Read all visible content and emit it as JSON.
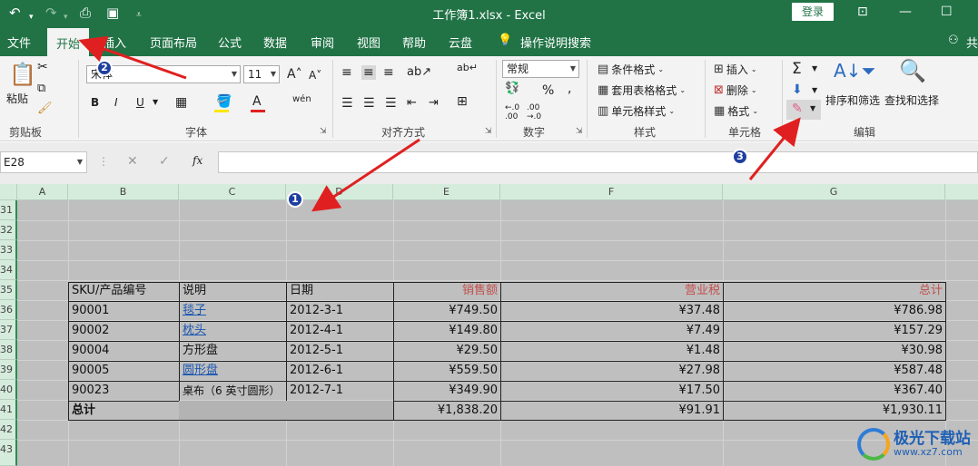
{
  "titlebar": {
    "undo_icon": "undo-icon",
    "redo_icon": "redo-icon",
    "doc_title": "工作簿1.xlsx  -  Excel",
    "login_label": "登录",
    "restore_icon": "ribbon-display-icon",
    "minimize_icon": "minimize-icon",
    "maximize_icon": "maximize-icon"
  },
  "tabs": [
    {
      "label": "文件"
    },
    {
      "label": "开始"
    },
    {
      "label": "插入"
    },
    {
      "label": "页面布局"
    },
    {
      "label": "公式"
    },
    {
      "label": "数据"
    },
    {
      "label": "审阅"
    },
    {
      "label": "视图"
    },
    {
      "label": "帮助"
    },
    {
      "label": "云盘"
    },
    {
      "label": "操作说明搜索"
    },
    {
      "label": "共"
    }
  ],
  "ribbon": {
    "clipboard": {
      "paste_label": "粘贴",
      "group_label": "剪贴板"
    },
    "font": {
      "font_name": "宋体",
      "font_size": "11",
      "bold": "B",
      "italic": "I",
      "underline": "U",
      "phonetic": "wén",
      "group_label": "字体"
    },
    "alignment": {
      "group_label": "对齐方式"
    },
    "number": {
      "format": "常规",
      "percent": "%",
      "comma": ",",
      "group_label": "数字"
    },
    "styles": {
      "conditional_format": "条件格式",
      "table_format": "套用表格格式",
      "cell_styles": "单元格样式",
      "group_label": "样式"
    },
    "cells": {
      "insert": "插入",
      "delete": "删除",
      "format": "格式",
      "group_label": "单元格"
    },
    "editing": {
      "sort_filter": "排序和筛选",
      "find_select": "查找和选择",
      "group_label": "编辑"
    }
  },
  "formula_bar": {
    "name_box": "E28",
    "fx_label": "fx",
    "formula_value": ""
  },
  "grid": {
    "columns": [
      "A",
      "B",
      "C",
      "D",
      "E",
      "F",
      "G"
    ],
    "rows": [
      "31",
      "32",
      "33",
      "34",
      "35",
      "36",
      "37",
      "38",
      "39",
      "40",
      "41",
      "42",
      "43"
    ],
    "table_header": {
      "sku": "SKU/产品编号",
      "desc": "说明",
      "date": "日期",
      "sales": "销售额",
      "tax": "营业税",
      "total": "总计"
    },
    "table_rows": [
      {
        "sku": "90001",
        "desc": "毯子",
        "date": "2012-3-1",
        "sales": "¥749.50",
        "tax": "¥37.48",
        "total": "¥786.98"
      },
      {
        "sku": "90002",
        "desc": "枕头",
        "date": "2012-4-1",
        "sales": "¥149.80",
        "tax": "¥7.49",
        "total": "¥157.29"
      },
      {
        "sku": "90004",
        "desc": "方形盘",
        "date": "2012-5-1",
        "sales": "¥29.50",
        "tax": "¥1.48",
        "total": "¥30.98"
      },
      {
        "sku": "90005",
        "desc": "圆形盘",
        "date": "2012-6-1",
        "sales": "¥559.50",
        "tax": "¥27.98",
        "total": "¥587.48"
      },
      {
        "sku": "90023",
        "desc": "桌布（6 英寸圆形）",
        "date": "2012-7-1",
        "sales": "¥349.90",
        "tax": "¥17.50",
        "total": "¥367.40"
      }
    ],
    "total_row": {
      "label": "总计",
      "sales": "¥1,838.20",
      "tax": "¥91.91",
      "total": "¥1,930.11"
    }
  },
  "annotations": {
    "badge1": "1",
    "badge2": "2",
    "badge3": "3",
    "arrow_color": "#e02020"
  },
  "watermark": {
    "name": "极光下载站",
    "url": "www.xz7.com"
  },
  "colors": {
    "excel_green": "#217346",
    "header_green": "#d5ebdc",
    "hyperlink": "#1a56b0",
    "header_red": "#c0504d"
  }
}
